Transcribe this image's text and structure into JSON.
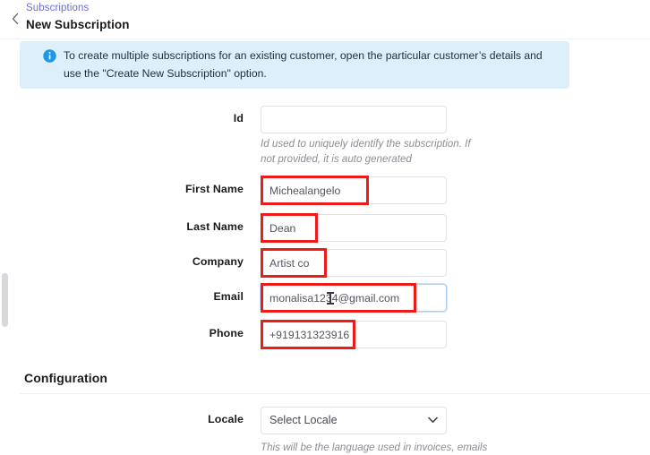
{
  "header": {
    "back_icon": "chevron-left-icon",
    "breadcrumb": "Subscriptions",
    "title": "New Subscription"
  },
  "banner": {
    "icon": "info-circle-icon",
    "text": "To create multiple subscriptions for an existing customer, open the particular customer’s details and use the \"Create New Subscription\" option.",
    "background_color": "#ddeffb",
    "icon_color": "#2196e3"
  },
  "form": {
    "fields": [
      {
        "label": "Id",
        "value": "",
        "placeholder": "",
        "helper": "Id used to uniquely identify the subscription. If not provided, it is auto generated",
        "highlighted": false,
        "focused": false
      },
      {
        "label": "First Name",
        "value": "Michealangelo",
        "placeholder": "",
        "helper": "",
        "highlighted": true,
        "focused": false
      },
      {
        "label": "Last Name",
        "value": "Dean",
        "placeholder": "",
        "helper": "",
        "highlighted": true,
        "focused": false
      },
      {
        "label": "Company",
        "value": "Artist co",
        "placeholder": "",
        "helper": "",
        "highlighted": true,
        "focused": false
      },
      {
        "label": "Email",
        "value": "monalisa1234@gmail.com",
        "placeholder": "",
        "helper": "",
        "highlighted": true,
        "focused": true
      },
      {
        "label": "Phone",
        "value": "+919131323916",
        "placeholder": "",
        "helper": "",
        "highlighted": true,
        "focused": false
      }
    ]
  },
  "configuration": {
    "title": "Configuration",
    "locale": {
      "label": "Locale",
      "selected": "Select Locale",
      "chevron_icon": "chevron-down-icon",
      "helper": "This will be the language used in invoices, emails"
    }
  },
  "annotation": {
    "color": "#ee1c19"
  },
  "cursor": {
    "type": "text-ibeam-cursor"
  }
}
